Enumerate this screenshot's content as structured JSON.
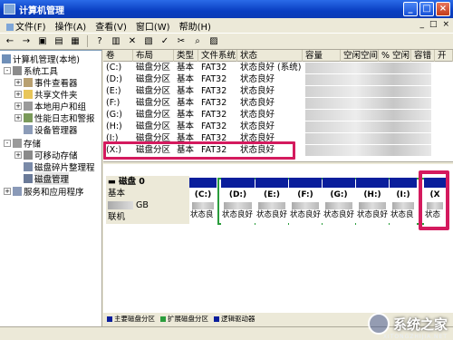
{
  "window": {
    "title": "计算机管理",
    "controls": [
      "_",
      "□",
      "×"
    ]
  },
  "menu": {
    "items": [
      "文件(F)",
      "操作(A)",
      "查看(V)",
      "窗口(W)",
      "帮助(H)"
    ],
    "right": [
      "_",
      "□",
      "×"
    ]
  },
  "toolbar": {
    "icons": [
      "back-icon",
      "forward-icon",
      "up-icon",
      "show-tree-icon",
      "properties-icon",
      "help-icon",
      "refresh-icon",
      "export-icon",
      "connect-icon",
      "check-icon",
      "delete-icon",
      "search-icon",
      "settings-icon"
    ]
  },
  "tree": {
    "items": [
      {
        "label": "计算机管理(本地)",
        "level": 0,
        "icon": "computer-icon"
      },
      {
        "label": "系统工具",
        "level": 1,
        "icon": "tools-icon",
        "expander": "-"
      },
      {
        "label": "事件查看器",
        "level": 2,
        "icon": "event-viewer-icon",
        "expander": "+"
      },
      {
        "label": "共享文件夹",
        "level": 2,
        "icon": "shared-folder-icon",
        "expander": "+"
      },
      {
        "label": "本地用户和组",
        "level": 2,
        "icon": "users-icon",
        "expander": "+"
      },
      {
        "label": "性能日志和警报",
        "level": 2,
        "icon": "performance-icon",
        "expander": "+"
      },
      {
        "label": "设备管理器",
        "level": 2,
        "icon": "device-manager-icon",
        "expander": ""
      },
      {
        "label": "存储",
        "level": 1,
        "icon": "storage-icon",
        "expander": "-"
      },
      {
        "label": "可移动存储",
        "level": 2,
        "icon": "removable-storage-icon",
        "expander": "+"
      },
      {
        "label": "磁盘碎片整理程",
        "level": 2,
        "icon": "defrag-icon",
        "expander": ""
      },
      {
        "label": "磁盘管理",
        "level": 2,
        "icon": "disk-management-icon",
        "expander": "",
        "selected": true
      },
      {
        "label": "服务和应用程序",
        "level": 1,
        "icon": "services-icon",
        "expander": "+"
      }
    ]
  },
  "volumes": {
    "columns": [
      "卷",
      "布局",
      "类型",
      "文件系统",
      "状态",
      "容量",
      "空闲空间",
      "% 空闲",
      "容错",
      "开"
    ],
    "rows": [
      {
        "volume": "(C:)",
        "layout": "磁盘分区",
        "type": "基本",
        "fs": "FAT32",
        "status": "状态良好 (系统)"
      },
      {
        "volume": "(D:)",
        "layout": "磁盘分区",
        "type": "基本",
        "fs": "FAT32",
        "status": "状态良好"
      },
      {
        "volume": "(E:)",
        "layout": "磁盘分区",
        "type": "基本",
        "fs": "FAT32",
        "status": "状态良好"
      },
      {
        "volume": "(F:)",
        "layout": "磁盘分区",
        "type": "基本",
        "fs": "FAT32",
        "status": "状态良好"
      },
      {
        "volume": "(G:)",
        "layout": "磁盘分区",
        "type": "基本",
        "fs": "FAT32",
        "status": "状态良好"
      },
      {
        "volume": "(H:)",
        "layout": "磁盘分区",
        "type": "基本",
        "fs": "FAT32",
        "status": "状态良好"
      },
      {
        "volume": "(I:)",
        "layout": "磁盘分区",
        "type": "基本",
        "fs": "FAT32",
        "status": "状态良好"
      },
      {
        "volume": "(X:)",
        "layout": "磁盘分区",
        "type": "基本",
        "fs": "FAT32",
        "status": "状态良好"
      }
    ]
  },
  "disk": {
    "name": "磁盘 0",
    "type": "基本",
    "size_unit": "GB",
    "status": "联机",
    "partitions": [
      {
        "letter": "(C:)",
        "state": "状态良"
      },
      {
        "letter": "(D:)",
        "state": "状态良好"
      },
      {
        "letter": "(E:)",
        "state": "状态良好"
      },
      {
        "letter": "(F:)",
        "state": "状态良好"
      },
      {
        "letter": "(G:)",
        "state": "状态良好"
      },
      {
        "letter": "(H:)",
        "state": "状态良好"
      },
      {
        "letter": "(I:)",
        "state": "状态良"
      },
      {
        "letter": "(X",
        "state": "状态"
      }
    ]
  },
  "legend": [
    {
      "label": "主要磁盘分区",
      "color": "#0a1e9c"
    },
    {
      "label": "扩展磁盘分区",
      "color": "#2a9d3c"
    },
    {
      "label": "逻辑驱动器",
      "color": "#0a1e9c"
    }
  ],
  "watermark": {
    "text": "系统之家",
    "url": "XITONGZHIJIA.NET"
  },
  "colors": {
    "highlight": "#d41a5e",
    "titlebar": "#0a3fc2",
    "primary_partition": "#0a1e9c",
    "extended_partition": "#2a9d3c"
  }
}
